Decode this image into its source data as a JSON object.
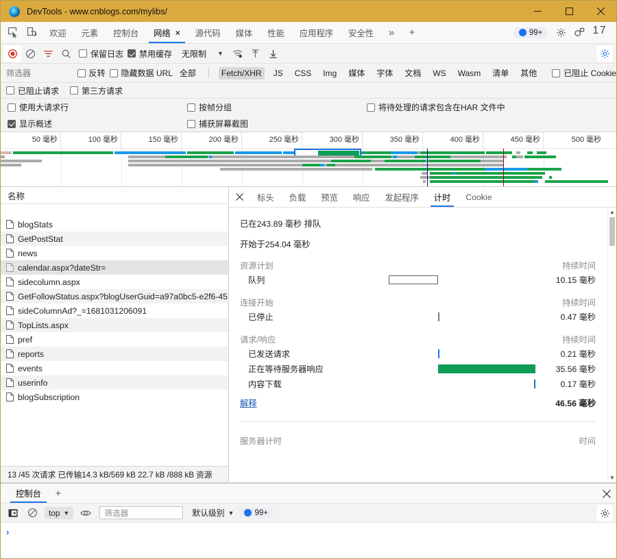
{
  "window": {
    "title": "DevTools - www.cnblogs.com/mylibs/",
    "controls": {
      "minimize": "minimize-icon",
      "maximize": "maximize-icon",
      "close": "close-icon"
    }
  },
  "tabstrip": {
    "inspect_icon": "inspect-element-icon",
    "device_icon": "device-toolbar-icon",
    "tabs": [
      {
        "label": "欢迎",
        "active": false
      },
      {
        "label": "元素",
        "active": false
      },
      {
        "label": "控制台",
        "active": false
      },
      {
        "label": "网络",
        "active": true,
        "closable": true,
        "close": "×"
      },
      {
        "label": "源代码",
        "active": false
      },
      {
        "label": "媒体",
        "active": false
      },
      {
        "label": "性能",
        "active": false
      },
      {
        "label": "应用程序",
        "active": false
      },
      {
        "label": "安全性",
        "active": false
      }
    ],
    "overflow": "»",
    "add": "+",
    "issues_badge": "99+",
    "settings_icon": "gear-icon",
    "customize_icon": "customize-icon",
    "more_icon": "more-options-icon"
  },
  "network_toolbar": {
    "record_icon": "record-stop-icon",
    "clear_icon": "clear-icon",
    "filter_icon": "filter-icon",
    "search_icon": "search-icon",
    "preserve_log": {
      "label": "保留日志",
      "checked": false
    },
    "disable_cache": {
      "label": "禁用缓存",
      "checked": true
    },
    "throttle_value": "无限制",
    "throttle_caret": "▼",
    "wifi_icon": "network-conditions-icon",
    "import_icon": "import-har-icon",
    "export_icon": "export-har-icon",
    "settings_icon": "network-settings-gear-icon"
  },
  "filter_row": {
    "placeholder": "筛选器",
    "invert": {
      "label": "反转",
      "checked": false
    },
    "hide_data_urls": {
      "label": "隐藏数据 URL",
      "checked": false
    },
    "types": [
      {
        "label": "全部",
        "selected": false
      },
      {
        "label": "Fetch/XHR",
        "selected": true
      },
      {
        "label": "JS",
        "selected": false
      },
      {
        "label": "CSS",
        "selected": false
      },
      {
        "label": "Img",
        "selected": false
      },
      {
        "label": "媒体",
        "selected": false
      },
      {
        "label": "字体",
        "selected": false
      },
      {
        "label": "文档",
        "selected": false
      },
      {
        "label": "WS",
        "selected": false
      },
      {
        "label": "Wasm",
        "selected": false
      },
      {
        "label": "清单",
        "selected": false
      },
      {
        "label": "其他",
        "selected": false
      }
    ],
    "blocked_cookies": {
      "label": "已阻止 Cookie",
      "checked": false
    }
  },
  "check_row_1": [
    {
      "label": "已阻止请求",
      "checked": false
    },
    {
      "label": "第三方请求",
      "checked": false
    }
  ],
  "check_row_2": [
    {
      "label": "使用大请求行",
      "checked": false
    },
    {
      "label": "按帧分组",
      "checked": false
    },
    {
      "label": "将待处理的请求包含在HAR 文件中",
      "checked": false
    },
    {
      "label": "显示概述",
      "checked": true
    },
    {
      "label": "捕获屏幕截图",
      "checked": false
    }
  ],
  "overview": {
    "ticks": [
      "50 毫秒",
      "100 毫秒",
      "150 毫秒",
      "200 毫秒",
      "250 毫秒",
      "300 毫秒",
      "350 毫秒",
      "400 毫秒",
      "450 毫秒",
      "500 毫秒"
    ],
    "selection": {
      "start_pct": 47.5,
      "width_pct": 11.0
    },
    "dcl_line_color": "#00008b",
    "load_line_color": "#b00000"
  },
  "requests": {
    "header": "名称",
    "items": [
      {
        "name": "blogStats",
        "icon": "document-icon"
      },
      {
        "name": "GetPostStat",
        "icon": "document-icon"
      },
      {
        "name": "news",
        "icon": "document-icon"
      },
      {
        "name": "calendar.aspx?dateStr=",
        "icon": "document-icon",
        "selected": true
      },
      {
        "name": "sidecolumn.aspx",
        "icon": "document-icon"
      },
      {
        "name": "GetFollowStatus.aspx?blogUserGuid=a97a0bc5-e2f6-45...",
        "icon": "document-icon"
      },
      {
        "name": "sideColumnAd?_=1681031206091",
        "icon": "document-icon"
      },
      {
        "name": "TopLists.aspx",
        "icon": "document-icon"
      },
      {
        "name": "pref",
        "icon": "document-icon"
      },
      {
        "name": "reports",
        "icon": "document-icon"
      },
      {
        "name": "events",
        "icon": "document-icon"
      },
      {
        "name": "userinfo",
        "icon": "document-icon"
      },
      {
        "name": "blogSubscription",
        "icon": "document-icon"
      }
    ],
    "status": "13 /45 次请求  已传输14.3 kB/569 kB  22.7 kB /888 kB 资源"
  },
  "detail": {
    "close": "×",
    "tabs": [
      {
        "label": "标头",
        "active": false
      },
      {
        "label": "负载",
        "active": false
      },
      {
        "label": "预览",
        "active": false
      },
      {
        "label": "响应",
        "active": false
      },
      {
        "label": "发起程序",
        "active": false
      },
      {
        "label": "计时",
        "active": true
      },
      {
        "label": "Cookie",
        "active": false
      }
    ],
    "timing": {
      "queued_line": "已在243.89 毫秒 排队",
      "started_line": "开始于254.04 毫秒",
      "sections": [
        {
          "title": "资源计划",
          "duration_header": "持续时间",
          "rows": [
            {
              "label": "队列",
              "duration": "10.15 毫秒",
              "bar": "hollow",
              "left_pct": 20,
              "width_pct": 26
            }
          ]
        },
        {
          "title": "连接开始",
          "duration_header": "持续时间",
          "rows": [
            {
              "label": "已停止",
              "duration": "0.47 毫秒",
              "bar": "dark",
              "left_pct": 46,
              "width_pct": 1
            }
          ]
        },
        {
          "title": "请求/响应",
          "duration_header": "持续时间",
          "rows": [
            {
              "label": "已发送请求",
              "duration": "0.21 毫秒",
              "bar": "bluethin",
              "left_pct": 46,
              "width_pct": 1
            },
            {
              "label": "正在等待服务器响应",
              "duration": "35.56 毫秒",
              "bar": "green",
              "left_pct": 46,
              "width_pct": 51
            },
            {
              "label": "内容下载",
              "duration": "0.17 毫秒",
              "bar": "bluethin",
              "left_pct": 97,
              "width_pct": 1
            }
          ]
        }
      ],
      "explain_link": "解释",
      "total": "46.56 毫秒",
      "server_timing_label": "服务器计时",
      "server_timing_header": "时间"
    }
  },
  "drawer": {
    "tabs": [
      {
        "label": "控制台",
        "active": true
      }
    ],
    "add": "+",
    "close": "×",
    "console_toolbar": {
      "sidebar_icon": "console-sidebar-icon",
      "clear_icon": "clear-console-icon",
      "context": "top",
      "context_caret": "▼",
      "eye_icon": "live-expression-icon",
      "filter_placeholder": "筛选器",
      "level": "默认级别",
      "level_caret": "▼",
      "issues_badge": "99+",
      "settings_icon": "console-settings-gear-icon"
    },
    "prompt": "›"
  },
  "colors": {
    "title_bar": "#dbaa3e",
    "accent": "#1a73e8",
    "green": "#0f9d58",
    "blue_bar": "#1a9ae8",
    "grey_bar": "#aaaaaa"
  }
}
